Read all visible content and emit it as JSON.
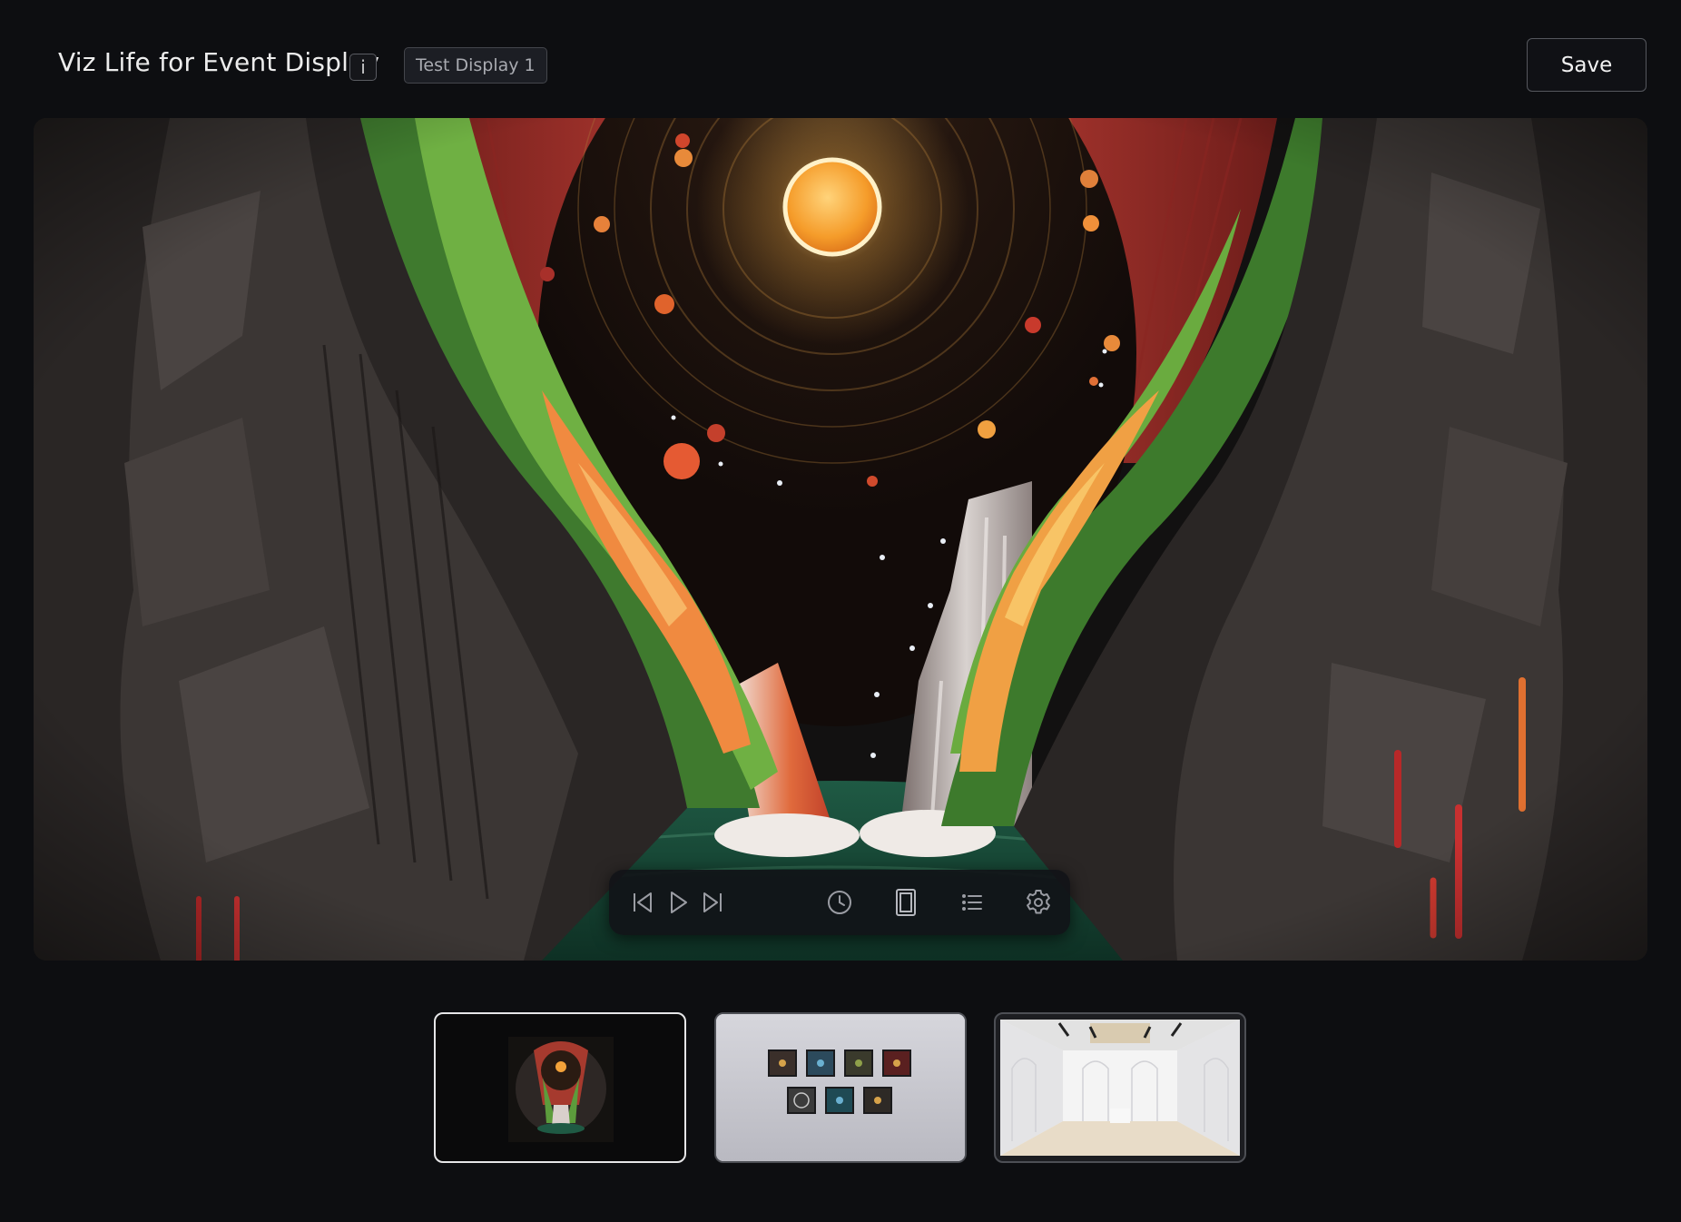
{
  "header": {
    "title": "Viz Life for Event Display",
    "info_label": "i",
    "display_tag": "Test Display 1",
    "save_label": "Save"
  },
  "stage": {
    "artwork": "papercut-canyon-waterfall-moon"
  },
  "player": {
    "buttons": [
      {
        "name": "previous-icon"
      },
      {
        "name": "play-icon"
      },
      {
        "name": "next-icon"
      },
      {
        "name": "clock-icon"
      },
      {
        "name": "portrait-frame-icon"
      },
      {
        "name": "list-icon"
      },
      {
        "name": "gear-icon"
      }
    ]
  },
  "thumbnails": [
    {
      "name": "single-artwork-view",
      "selected": true
    },
    {
      "name": "gallery-wall-view",
      "selected": false
    },
    {
      "name": "room-view",
      "selected": false
    }
  ],
  "colors": {
    "background": "#0d0e11",
    "accent_border": "#e6e6e8",
    "muted_border": "#4d4f55"
  }
}
